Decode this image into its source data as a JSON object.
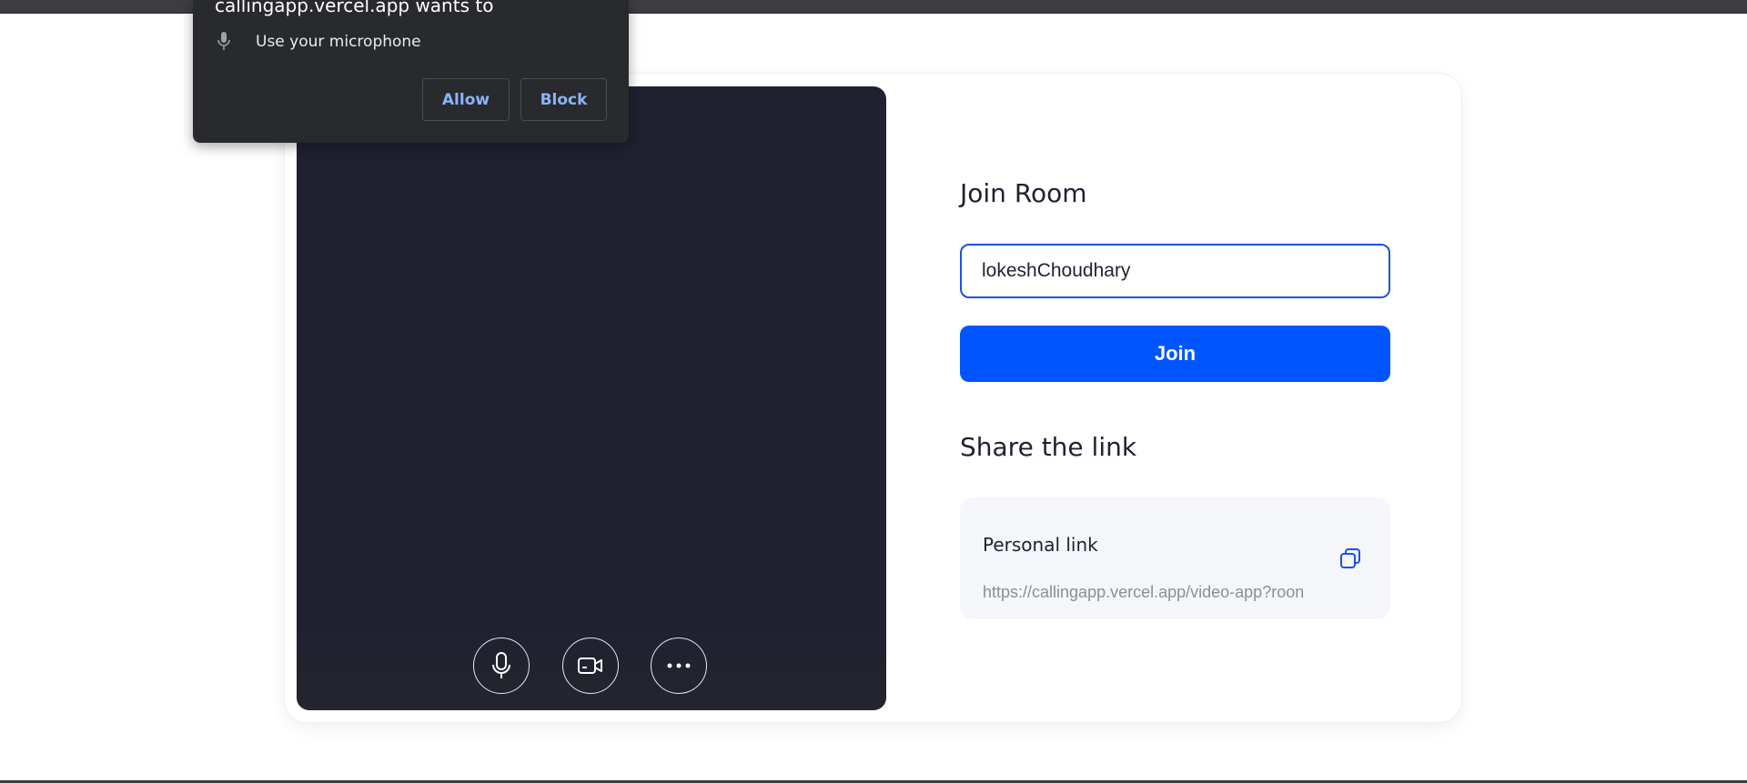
{
  "permission_prompt": {
    "title": "callingapp.vercel.app wants to",
    "request": "Use your microphone",
    "allow_label": "Allow",
    "block_label": "Block",
    "icon": "microphone-icon"
  },
  "video": {
    "controls": [
      {
        "name": "microphone",
        "icon": "microphone-icon"
      },
      {
        "name": "camera",
        "icon": "video-camera-icon"
      },
      {
        "name": "more",
        "icon": "more-horizontal-icon"
      }
    ]
  },
  "join": {
    "heading": "Join Room",
    "name_value": "lokeshChoudhary",
    "button_label": "Join"
  },
  "share": {
    "heading": "Share the link",
    "link_title": "Personal link",
    "link_url": "https://callingapp.vercel.app/video-app?roon",
    "copy_icon": "copy-icon"
  },
  "colors": {
    "accent": "#0055ff",
    "video_bg": "#1f2130",
    "popup_bg": "#292a2d",
    "popup_link": "#8ab4f8"
  }
}
